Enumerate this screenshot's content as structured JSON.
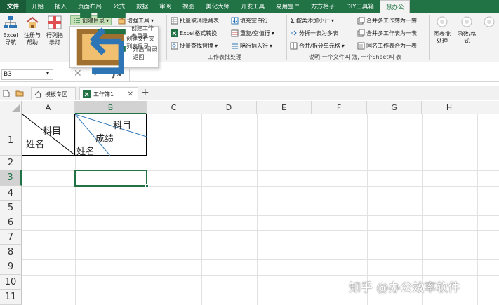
{
  "menubar": {
    "items": [
      "文件",
      "开始",
      "插入",
      "页面布局",
      "公式",
      "数据",
      "审阅",
      "视图",
      "美化大师",
      "开发工具",
      "易用宝™",
      "方方格子",
      "DIY工具箱",
      "慧办公"
    ]
  },
  "ribbon": {
    "big_buttons": {
      "excel_nav": "Excel\n导航",
      "register_help": "注册与\n帮助",
      "row_col_highlight": "行列指\n示灯"
    },
    "create_toc": "创建目录",
    "enhance_tools": "增强工具",
    "batch": {
      "cancel_hide": "批量取消隐藏表",
      "excel_convert": "Excel格式转换",
      "batch_find_replace": "批量查找替换",
      "fill_blank_rows": "填充空白行",
      "repeat_empty_rows": "重复/空值行",
      "interval_insert_rows": "隔行插入行"
    },
    "group_label_batch": "工作表批处理",
    "merge": {
      "sum_by_category": "按类添加小计",
      "split_table": "分拆一表为多表",
      "merge_split_cells": "合并/拆分单元格",
      "merge_sheets_one": "合并多工作簿为一簿",
      "merge_sheets_table": "合并多工作表为一表",
      "merge_same_name": "同名工作表合为一表"
    },
    "group_label_merge": "说明:一个文件叫 簿, 一个Sheet叫 表",
    "right_buttons": {
      "chart_batch": "图表批\n处理",
      "function_format": "函数/格\n式"
    }
  },
  "dropdown": {
    "items": [
      "创建工作表目录",
      "创建文件夹列表目录",
      "开启 目录返回"
    ]
  },
  "formula_bar": {
    "name_box": "B3",
    "fx": "fx",
    "value": ""
  },
  "tabs": {
    "template_zone": "模板专区",
    "workbook": "工作簿1"
  },
  "columns": [
    "A",
    "B",
    "C",
    "D",
    "E",
    "F",
    "G",
    "H"
  ],
  "rows": [
    "1",
    "2",
    "3",
    "4",
    "5",
    "6",
    "7",
    "8",
    "9",
    "10",
    "11"
  ],
  "cells": {
    "a1_top": "科目",
    "a1_bottom": "姓名",
    "b1_top": "科目",
    "b1_mid": "成绩",
    "b1_bottom": "姓名"
  },
  "watermark": "知乎 @办公效率软件",
  "colors": {
    "excel_green": "#217346",
    "ribbon_bg": "#f3f3f3"
  }
}
